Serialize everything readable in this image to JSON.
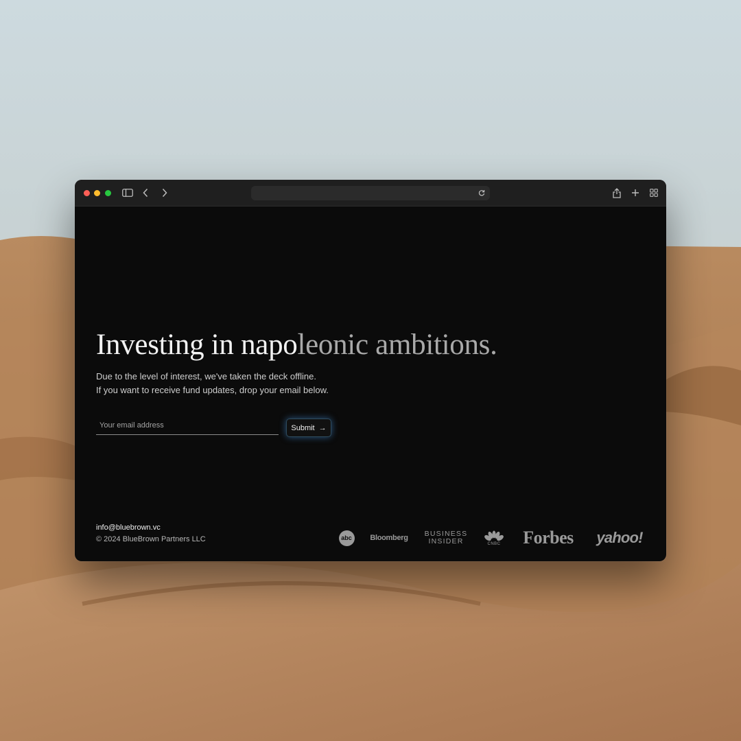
{
  "browser": {
    "address": ""
  },
  "page": {
    "headline_main": "Investing in napo",
    "headline_accent": "leonic ambitions.",
    "sub_line1": "Due to the level of interest, we've taken the deck offline.",
    "sub_line2": "If you want to receive fund updates, drop your email below.",
    "email_placeholder": "Your email address",
    "submit_label": "Submit",
    "submit_arrow": "→"
  },
  "footer": {
    "email": "info@bluebrown.vc",
    "copyright": "© 2024 BlueBrown Partners LLC"
  },
  "press": {
    "abc": "abc",
    "bloomberg": "Bloomberg",
    "business_insider_line1": "BUSINESS",
    "business_insider_line2": "INSIDER",
    "cnbc": "CNBC",
    "forbes": "Forbes",
    "yahoo": "yahoo!"
  },
  "colors": {
    "traffic_red": "#ff5f57",
    "traffic_yellow": "#febc2e",
    "traffic_green": "#28c840",
    "logo_blue": "#2f8fd8",
    "logo_bronze": "#b8875a",
    "page_background": "#0b0b0b"
  }
}
